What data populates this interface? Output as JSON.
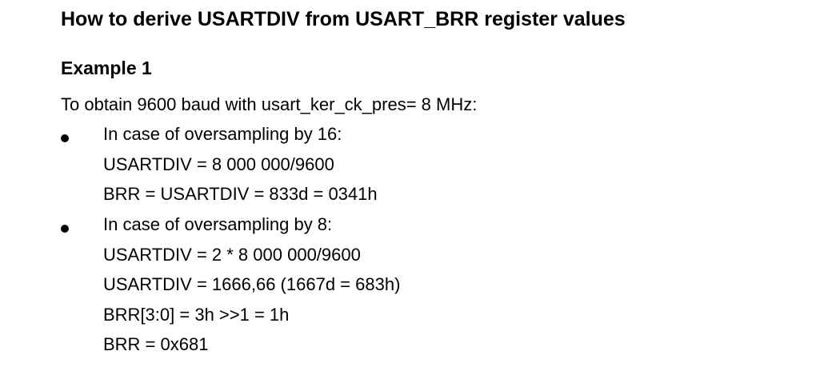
{
  "document": {
    "title": "How to derive USARTDIV from USART_BRR register values",
    "example_heading": "Example 1",
    "intro": "To obtain 9600 baud with usart_ker_ck_pres= 8 MHz:",
    "cases": [
      {
        "heading": "In case of oversampling by 16:",
        "lines": [
          "USARTDIV = 8 000 000/9600",
          "BRR = USARTDIV = 833d = 0341h"
        ]
      },
      {
        "heading": "In case of oversampling by 8:",
        "lines": [
          "USARTDIV = 2 * 8 000 000/9600",
          "USARTDIV = 1666,66 (1667d = 683h)",
          "BRR[3:0] = 3h >>1 = 1h",
          "BRR = 0x681"
        ]
      }
    ]
  }
}
